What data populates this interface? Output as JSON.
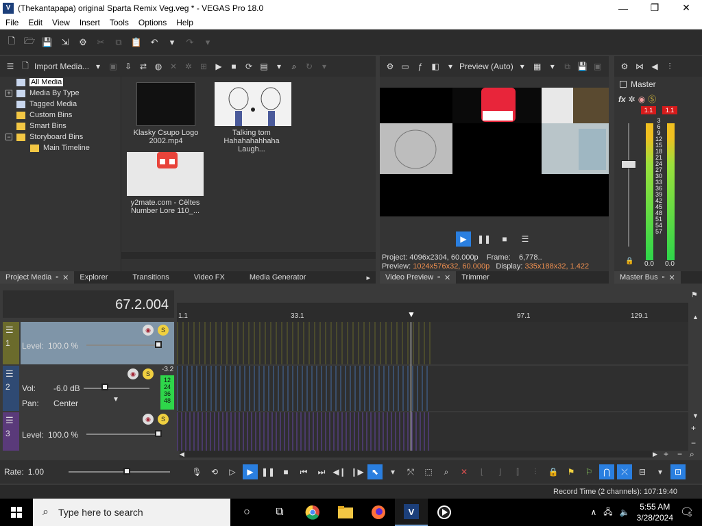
{
  "window": {
    "title": "(Thekantapapa) original Sparta Remix Veg.veg * - VEGAS Pro 18.0",
    "app_icon": "V",
    "minimize": "—",
    "maximize": "❐",
    "close": "✕"
  },
  "menu": [
    "File",
    "Edit",
    "View",
    "Insert",
    "Tools",
    "Options",
    "Help"
  ],
  "project_media": {
    "import_label": "Import Media...",
    "tree": [
      {
        "label": "All Media",
        "selected": true,
        "expander": ""
      },
      {
        "label": "Media By Type",
        "expander": "+"
      },
      {
        "label": "Tagged Media",
        "expander": ""
      },
      {
        "label": "Custom Bins",
        "expander": ""
      },
      {
        "label": "Smart Bins",
        "expander": ""
      },
      {
        "label": "Storyboard Bins",
        "expander": "−"
      },
      {
        "label": "Main Timeline",
        "expander": ""
      }
    ],
    "media": [
      {
        "caption": "Klasky Csupo Logo 2002.mp4"
      },
      {
        "caption": "Talking tom Hahahahahhaha Laugh..."
      },
      {
        "caption": "y2mate.com - Cëltes Number Lore 110_..."
      }
    ]
  },
  "left_tabs": [
    "Project Media",
    "Explorer",
    "Transitions",
    "Video FX",
    "Media Generator"
  ],
  "video_preview": {
    "quality": "Preview (Auto)",
    "project_label": "Project:",
    "project_value": "4096x2304, 60.000p",
    "frame_label": "Frame:",
    "frame_value": "6,778..",
    "preview_label": "Preview:",
    "preview_value": "1024x576x32, 60.000p",
    "display_label": "Display:",
    "display_value": "335x188x32, 1.422"
  },
  "middle_tabs": [
    "Video Preview",
    "Trimmer"
  ],
  "master": {
    "label": "Master",
    "fx": "fx",
    "peak_left": "1.1",
    "peak_right": "1.1",
    "scale": [
      "3",
      "6",
      "9",
      "12",
      "15",
      "18",
      "21",
      "24",
      "27",
      "30",
      "33",
      "36",
      "39",
      "42",
      "45",
      "48",
      "51",
      "54",
      "57"
    ],
    "bottom_left": "0.0",
    "bottom_right": "0.0",
    "tab": "Master Bus"
  },
  "timeline": {
    "timecode": "67.2.004",
    "ruler": [
      "1.1",
      "33.1",
      "97.1",
      "129.1"
    ],
    "tracks": [
      {
        "num": "1",
        "level_label": "Level:",
        "level_value": "100.0 %"
      },
      {
        "num": "2",
        "vol_label": "Vol:",
        "vol_value": "-6.0 dB",
        "pan_label": "Pan:",
        "pan_value": "Center",
        "meter_top": "-3.2",
        "meter_scale": [
          "12",
          "24",
          "36",
          "48"
        ]
      },
      {
        "num": "3",
        "level_label": "Level:",
        "level_value": "100.0 %"
      }
    ],
    "rate_label": "Rate:",
    "rate_value": "1.00"
  },
  "status": {
    "record_time": "Record Time (2 channels): 107:19:40"
  },
  "taskbar": {
    "search_placeholder": "Type here to search",
    "time": "5:55 AM",
    "date": "3/28/2024",
    "notifications": "5"
  }
}
